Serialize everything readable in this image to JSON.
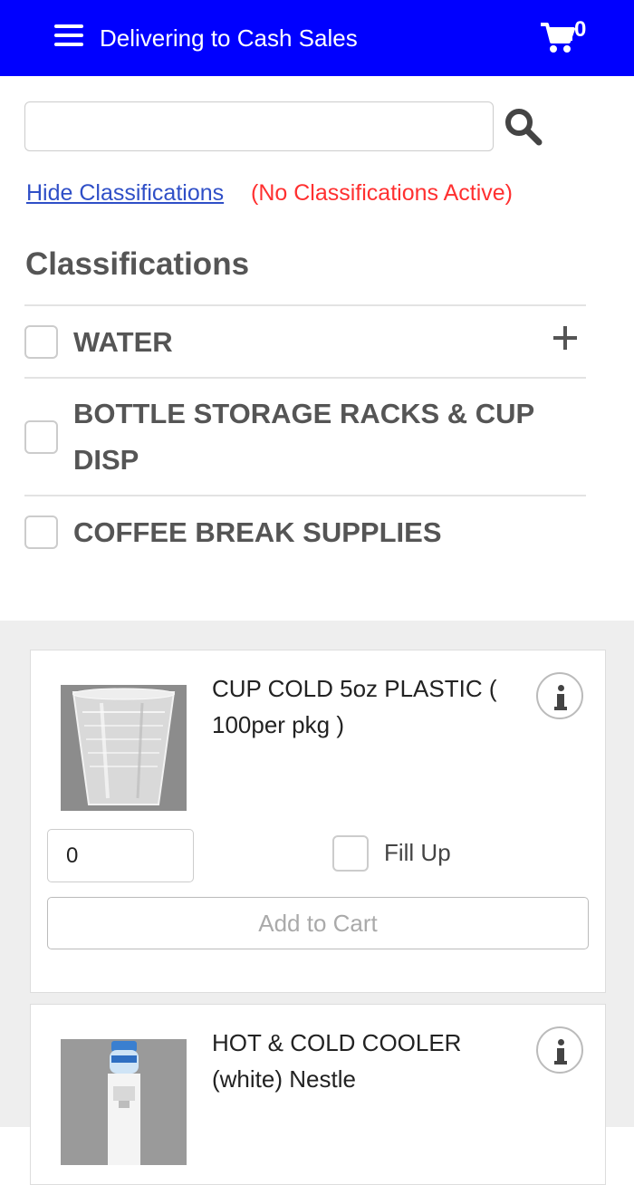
{
  "header": {
    "location_text": "Delivering to Cash Sales",
    "cart_count": "0"
  },
  "search": {
    "value": "",
    "placeholder": ""
  },
  "classifications": {
    "hide_link": "Hide Classifications",
    "status": "(No Classifications Active)",
    "title": "Classifications",
    "items": [
      {
        "label": "WATER",
        "expandable": true
      },
      {
        "label": "BOTTLE STORAGE RACKS & CUP DISP",
        "expandable": false
      },
      {
        "label": "COFFEE BREAK SUPPLIES",
        "expandable": false
      }
    ]
  },
  "products": [
    {
      "name": "CUP COLD 5oz PLASTIC ( 100per pkg )",
      "quantity": "0",
      "fill_up_label": "Fill Up",
      "add_label": "Add to Cart"
    },
    {
      "name": "HOT & COLD COOLER (white) Nestle"
    }
  ],
  "colors": {
    "header_bg": "#0000ff",
    "link": "#2f4fc7",
    "status_red": "#ff3030"
  },
  "icons": {
    "menu": "hamburger-icon",
    "cart": "cart-icon",
    "search": "search-icon",
    "expand": "plus-icon",
    "info": "info-icon"
  }
}
